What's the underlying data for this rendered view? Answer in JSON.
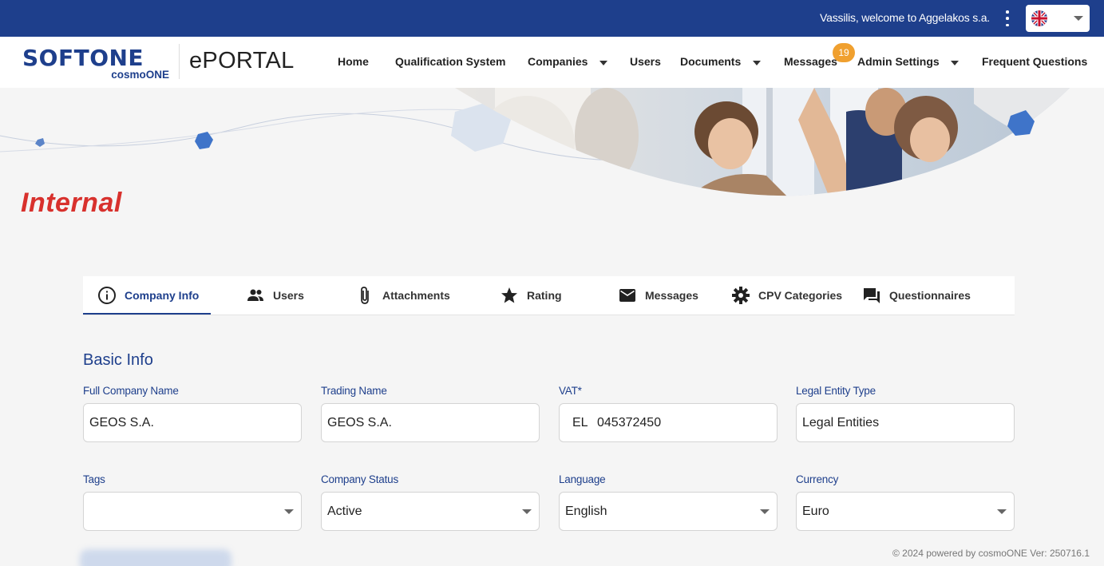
{
  "topbar": {
    "welcome": "Vassilis, welcome to Aggelakos s.a.",
    "language_flag": "uk-flag-icon"
  },
  "brand": {
    "logo_main": "SOFTONE",
    "logo_sub": "cosmoONE",
    "portal": "ePORTAL",
    "color": "#1e3f8c"
  },
  "nav": {
    "home": "Home",
    "qualification": "Qualification System",
    "companies": "Companies",
    "users": "Users",
    "documents": "Documents",
    "messages": "Messages",
    "messages_badge": "19",
    "admin": "Admin Settings",
    "faq": "Frequent Questions"
  },
  "page": {
    "title": "Internal",
    "title_color": "#d8312d"
  },
  "tabs": [
    {
      "label": "Company Info",
      "icon": "info-icon",
      "active": true
    },
    {
      "label": "Users",
      "icon": "people-icon"
    },
    {
      "label": "Attachments",
      "icon": "paperclip-icon"
    },
    {
      "label": "Rating",
      "icon": "star-icon"
    },
    {
      "label": "Messages",
      "icon": "mail-icon"
    },
    {
      "label": "CPV Categories",
      "icon": "gear-icon"
    },
    {
      "label": "Questionnaires",
      "icon": "chat-icon"
    }
  ],
  "form": {
    "section_title": "Basic Info",
    "full_company_name": {
      "label": "Full Company Name",
      "value": "GEOS S.A."
    },
    "trading_name": {
      "label": "Trading Name",
      "value": "GEOS S.A."
    },
    "vat": {
      "label": "VAT*",
      "prefix": "EL",
      "value": "045372450"
    },
    "legal_entity_type": {
      "label": "Legal Entity Type",
      "value": "Legal Entities"
    },
    "tags": {
      "label": "Tags",
      "value": ""
    },
    "company_status": {
      "label": "Company Status",
      "value": "Active"
    },
    "language": {
      "label": "Language",
      "value": "English"
    },
    "currency": {
      "label": "Currency",
      "value": "Euro"
    }
  },
  "footer": {
    "text": "© 2024 powered by cosmoONE  Ver: 250716.1"
  }
}
